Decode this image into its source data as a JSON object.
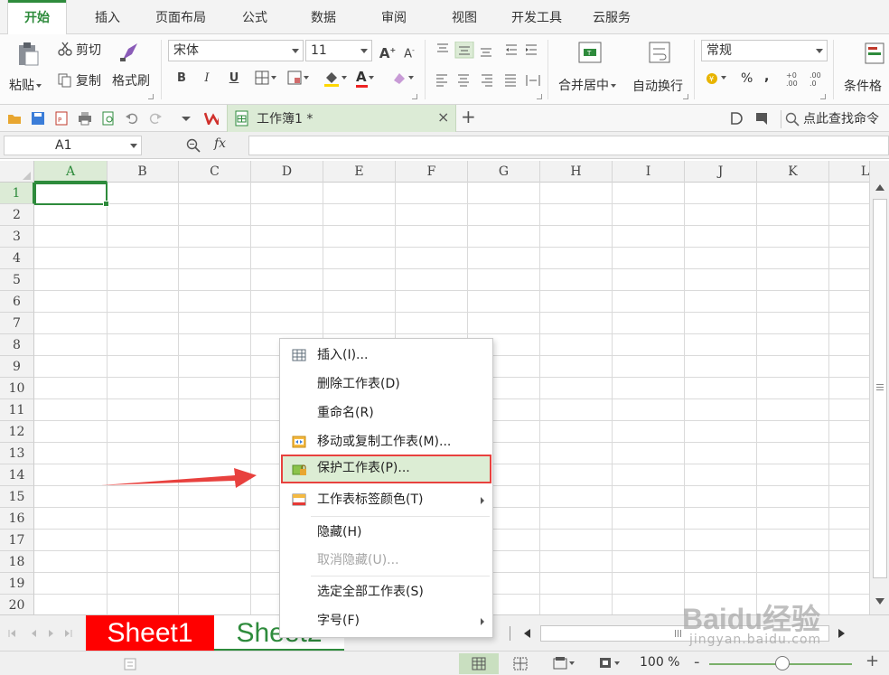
{
  "menu_tabs": [
    "开始",
    "插入",
    "页面布局",
    "公式",
    "数据",
    "审阅",
    "视图",
    "开发工具",
    "云服务"
  ],
  "ribbon": {
    "paste": "粘贴",
    "cut": "剪切",
    "copy": "复制",
    "format_painter": "格式刷",
    "font_name": "宋体",
    "font_size": "11",
    "merge_center": "合并居中",
    "wrap_text": "自动换行",
    "number_format": "常规",
    "percent": "%",
    "comma": ",",
    "conditional_format": "条件格",
    "bold": "B",
    "italic": "I",
    "underline": "U",
    "grow_font": "A",
    "shrink_font": "A",
    "font_color_letter": "A"
  },
  "quick_access": {
    "doc_tab": "工作簿1 *",
    "close": "×",
    "new_tab": "+",
    "search": "点此查找命令"
  },
  "formula_bar": {
    "name_box": "A1",
    "fx": "fx"
  },
  "grid": {
    "columns": [
      "A",
      "B",
      "C",
      "D",
      "E",
      "F",
      "G",
      "H",
      "I",
      "J",
      "K",
      "L"
    ],
    "rows": [
      "1",
      "2",
      "3",
      "4",
      "5",
      "6",
      "7",
      "8",
      "9",
      "10",
      "11",
      "12",
      "13",
      "14",
      "15",
      "16",
      "17",
      "18",
      "19",
      "20"
    ],
    "selected_cell": "A1"
  },
  "sheets": [
    "Sheet1",
    "Sheet2"
  ],
  "status": {
    "zoom": "100 %",
    "zoom_minus": "-",
    "zoom_plus": "+"
  },
  "context_menu": [
    {
      "label": "插入(I)...",
      "icon": "insert-table-icon",
      "enabled": true,
      "submenu": false
    },
    {
      "label": "删除工作表(D)",
      "icon": "",
      "enabled": true,
      "submenu": false
    },
    {
      "label": "重命名(R)",
      "icon": "",
      "enabled": true,
      "submenu": false
    },
    {
      "label": "移动或复制工作表(M)...",
      "icon": "move-copy-icon",
      "enabled": true,
      "submenu": false
    },
    {
      "label": "保护工作表(P)...",
      "icon": "protect-sheet-icon",
      "enabled": true,
      "submenu": false,
      "highlighted": true
    },
    {
      "label": "工作表标签颜色(T)",
      "icon": "tab-color-icon",
      "enabled": true,
      "submenu": true
    },
    {
      "label": "隐藏(H)",
      "icon": "",
      "enabled": true,
      "submenu": false
    },
    {
      "label": "取消隐藏(U)...",
      "icon": "",
      "enabled": false,
      "submenu": false
    },
    {
      "label": "选定全部工作表(S)",
      "icon": "",
      "enabled": true,
      "submenu": false
    },
    {
      "label": "字号(F)",
      "icon": "",
      "enabled": true,
      "submenu": true
    }
  ],
  "watermark": {
    "brand": "Baidu经验",
    "url": "jingyan.baidu.com"
  },
  "colors": {
    "accent": "#2e8b3c",
    "selection_fill": "#dcebd6",
    "annotation_red": "#e8413e",
    "sheet1_tab": "#ff0000"
  }
}
